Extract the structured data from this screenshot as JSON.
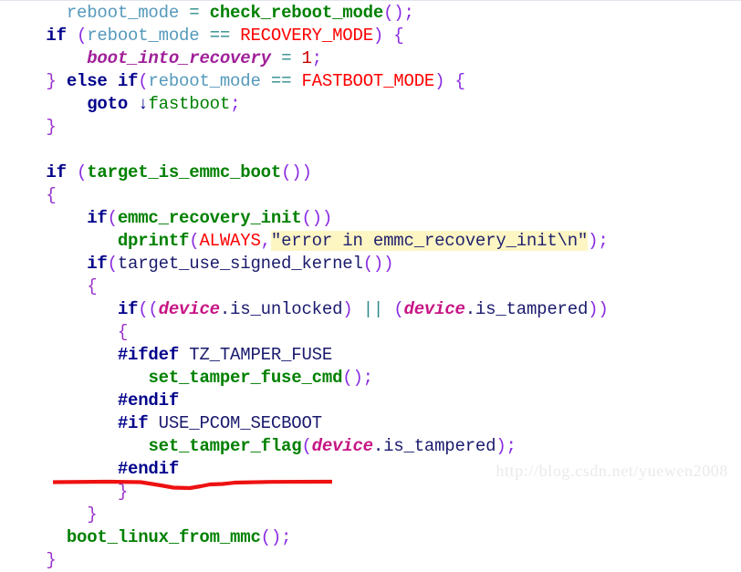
{
  "document": {
    "kind": "source-code-listing",
    "language": "c",
    "background_color": "#ffffff"
  },
  "palette": {
    "variable": "#5599bb",
    "keyword": "#00008b",
    "function": "#008000",
    "macro_red": "#ff0000",
    "number": "#cc0000",
    "punctuation": "#8a2be2",
    "operator": "#2e8b8b",
    "member_object": "#c71585",
    "string_text": "#22226e",
    "string_highlight_bg": "#fdf6c3",
    "preprocessor": "#00008b",
    "plain_text": "#1a1a6e",
    "annotation_underline": "#ee1111",
    "watermark_text": "#eaeaea"
  },
  "code": {
    "lines": [
      {
        "id": "line-1",
        "tokens": [
          {
            "text": "    ",
            "style": "t-plain"
          },
          {
            "text": "reboot_mode",
            "style": "t-var"
          },
          {
            "text": " ",
            "style": "t-plain"
          },
          {
            "text": "=",
            "style": "t-op"
          },
          {
            "text": " ",
            "style": "t-plain"
          },
          {
            "text": "check_reboot_mode",
            "style": "t-fn"
          },
          {
            "text": "();",
            "style": "t-punct"
          }
        ]
      },
      {
        "id": "line-2",
        "tokens": [
          {
            "text": "  ",
            "style": "t-plain"
          },
          {
            "text": "if",
            "style": "t-kw"
          },
          {
            "text": " ",
            "style": "t-plain"
          },
          {
            "text": "(",
            "style": "t-punct"
          },
          {
            "text": "reboot_mode",
            "style": "t-var"
          },
          {
            "text": " ",
            "style": "t-plain"
          },
          {
            "text": "==",
            "style": "t-op"
          },
          {
            "text": " ",
            "style": "t-plain"
          },
          {
            "text": "RECOVERY_MODE",
            "style": "t-macro-red"
          },
          {
            "text": ") {",
            "style": "t-punct"
          }
        ]
      },
      {
        "id": "line-3",
        "tokens": [
          {
            "text": "      ",
            "style": "t-plain"
          },
          {
            "text": "boot_into_recovery",
            "style": "t-ital-mag"
          },
          {
            "text": " ",
            "style": "t-plain"
          },
          {
            "text": "=",
            "style": "t-op"
          },
          {
            "text": " ",
            "style": "t-plain"
          },
          {
            "text": "1",
            "style": "t-num"
          },
          {
            "text": ";",
            "style": "t-punct"
          }
        ]
      },
      {
        "id": "line-4",
        "tokens": [
          {
            "text": "  ",
            "style": "t-plain"
          },
          {
            "text": "}",
            "style": "t-brace"
          },
          {
            "text": " ",
            "style": "t-plain"
          },
          {
            "text": "else if",
            "style": "t-kw"
          },
          {
            "text": "(",
            "style": "t-punct"
          },
          {
            "text": "reboot_mode",
            "style": "t-var"
          },
          {
            "text": " ",
            "style": "t-plain"
          },
          {
            "text": "==",
            "style": "t-op"
          },
          {
            "text": " ",
            "style": "t-plain"
          },
          {
            "text": "FASTBOOT_MODE",
            "style": "t-macro-red"
          },
          {
            "text": ") {",
            "style": "t-punct"
          }
        ]
      },
      {
        "id": "line-5",
        "tokens": [
          {
            "text": "      ",
            "style": "t-plain"
          },
          {
            "text": "goto",
            "style": "t-kw"
          },
          {
            "text": " ",
            "style": "t-plain"
          },
          {
            "text": "↓",
            "style": "t-arrow"
          },
          {
            "text": "fastboot",
            "style": "t-fn-plain"
          },
          {
            "text": ";",
            "style": "t-punct"
          }
        ]
      },
      {
        "id": "line-6",
        "tokens": [
          {
            "text": "  ",
            "style": "t-plain"
          },
          {
            "text": "}",
            "style": "t-brace"
          }
        ]
      },
      {
        "id": "line-7",
        "tokens": [
          {
            "text": "",
            "style": "t-plain"
          }
        ]
      },
      {
        "id": "line-8",
        "tokens": [
          {
            "text": "  ",
            "style": "t-plain"
          },
          {
            "text": "if",
            "style": "t-kw"
          },
          {
            "text": " ",
            "style": "t-plain"
          },
          {
            "text": "(",
            "style": "t-punct"
          },
          {
            "text": "target_is_emmc_boot",
            "style": "t-fn"
          },
          {
            "text": "())",
            "style": "t-punct"
          }
        ]
      },
      {
        "id": "line-9",
        "tokens": [
          {
            "text": "  ",
            "style": "t-plain"
          },
          {
            "text": "{",
            "style": "t-brace"
          }
        ]
      },
      {
        "id": "line-10",
        "tokens": [
          {
            "text": "      ",
            "style": "t-plain"
          },
          {
            "text": "if",
            "style": "t-kw"
          },
          {
            "text": "(",
            "style": "t-punct"
          },
          {
            "text": "emmc_recovery_init",
            "style": "t-fn"
          },
          {
            "text": "())",
            "style": "t-punct"
          }
        ]
      },
      {
        "id": "line-11",
        "tokens": [
          {
            "text": "         ",
            "style": "t-plain"
          },
          {
            "text": "dprintf",
            "style": "t-fn"
          },
          {
            "text": "(",
            "style": "t-punct"
          },
          {
            "text": "ALWAYS",
            "style": "t-macro-red"
          },
          {
            "text": ",",
            "style": "t-punct"
          },
          {
            "text": "\"error in emmc_recovery_init\\n\"",
            "style": "t-str"
          },
          {
            "text": ");",
            "style": "t-punct"
          }
        ]
      },
      {
        "id": "line-12",
        "tokens": [
          {
            "text": "      ",
            "style": "t-plain"
          },
          {
            "text": "if",
            "style": "t-kw"
          },
          {
            "text": "(",
            "style": "t-punct"
          },
          {
            "text": "target_use_signed_kernel",
            "style": "t-field"
          },
          {
            "text": "())",
            "style": "t-punct"
          }
        ]
      },
      {
        "id": "line-13",
        "tokens": [
          {
            "text": "      ",
            "style": "t-plain"
          },
          {
            "text": "{",
            "style": "t-brace"
          }
        ]
      },
      {
        "id": "line-14",
        "tokens": [
          {
            "text": "         ",
            "style": "t-plain"
          },
          {
            "text": "if",
            "style": "t-kw"
          },
          {
            "text": "((",
            "style": "t-punct"
          },
          {
            "text": "device",
            "style": "t-member"
          },
          {
            "text": ".is_unlocked",
            "style": "t-field"
          },
          {
            "text": ")",
            "style": "t-punct"
          },
          {
            "text": " ",
            "style": "t-plain"
          },
          {
            "text": "||",
            "style": "t-op"
          },
          {
            "text": " ",
            "style": "t-plain"
          },
          {
            "text": "(",
            "style": "t-punct"
          },
          {
            "text": "device",
            "style": "t-member"
          },
          {
            "text": ".is_tampered",
            "style": "t-field"
          },
          {
            "text": "))",
            "style": "t-punct"
          }
        ]
      },
      {
        "id": "line-15",
        "tokens": [
          {
            "text": "         ",
            "style": "t-plain"
          },
          {
            "text": "{",
            "style": "t-brace"
          }
        ]
      },
      {
        "id": "line-16",
        "tokens": [
          {
            "text": "         ",
            "style": "t-plain"
          },
          {
            "text": "#ifdef",
            "style": "t-pp"
          },
          {
            "text": " ",
            "style": "t-plain"
          },
          {
            "text": "TZ_TAMPER_FUSE",
            "style": "t-ppname"
          }
        ]
      },
      {
        "id": "line-17",
        "tokens": [
          {
            "text": "            ",
            "style": "t-plain"
          },
          {
            "text": "set_tamper_fuse_cmd",
            "style": "t-fn"
          },
          {
            "text": "();",
            "style": "t-punct"
          }
        ]
      },
      {
        "id": "line-18",
        "tokens": [
          {
            "text": "         ",
            "style": "t-plain"
          },
          {
            "text": "#endif",
            "style": "t-pp"
          }
        ]
      },
      {
        "id": "line-19",
        "tokens": [
          {
            "text": "         ",
            "style": "t-plain"
          },
          {
            "text": "#if",
            "style": "t-pp"
          },
          {
            "text": " ",
            "style": "t-plain"
          },
          {
            "text": "USE_PCOM_SECBOOT",
            "style": "t-ppname"
          }
        ]
      },
      {
        "id": "line-20",
        "tokens": [
          {
            "text": "            ",
            "style": "t-plain"
          },
          {
            "text": "set_tamper_flag",
            "style": "t-fn"
          },
          {
            "text": "(",
            "style": "t-punct"
          },
          {
            "text": "device",
            "style": "t-member"
          },
          {
            "text": ".is_tampered",
            "style": "t-field"
          },
          {
            "text": ");",
            "style": "t-punct"
          }
        ]
      },
      {
        "id": "line-21",
        "tokens": [
          {
            "text": "         ",
            "style": "t-plain"
          },
          {
            "text": "#endif",
            "style": "t-pp"
          }
        ]
      },
      {
        "id": "line-22",
        "tokens": [
          {
            "text": "         ",
            "style": "t-plain"
          },
          {
            "text": "}",
            "style": "t-brace"
          }
        ]
      },
      {
        "id": "line-23",
        "tokens": [
          {
            "text": "      ",
            "style": "t-plain"
          },
          {
            "text": "}",
            "style": "t-brace"
          }
        ]
      },
      {
        "id": "line-24",
        "tokens": [
          {
            "text": "    ",
            "style": "t-plain"
          },
          {
            "text": "boot_linux_from_mmc",
            "style": "t-fn"
          },
          {
            "text": "();",
            "style": "t-punct"
          }
        ]
      },
      {
        "id": "line-25",
        "tokens": [
          {
            "text": "  ",
            "style": "t-plain"
          },
          {
            "text": "}",
            "style": "t-brace"
          }
        ]
      }
    ]
  },
  "annotations": {
    "underline": {
      "target_line_id": "line-24",
      "target_text": "boot_linux_from_mmc();",
      "color": "#ee1111",
      "style": "hand-drawn-wavy"
    }
  },
  "watermark": {
    "text": "http://blog.csdn.net/yuewen2008"
  }
}
